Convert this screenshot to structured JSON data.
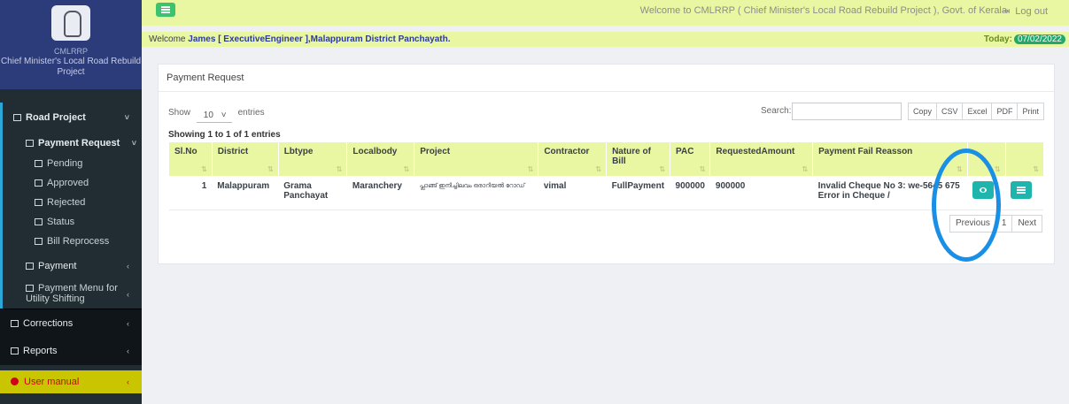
{
  "brand": {
    "short": "CMLRRP",
    "full": "Chief Minister's Local Road Rebuild Project"
  },
  "sidebar": {
    "road_project": "Road Project",
    "payment_request": "Payment Request",
    "pending": "Pending",
    "approved": "Approved",
    "rejected": "Rejected",
    "status": "Status",
    "bill_reprocess": "Bill Reprocess",
    "payment": "Payment",
    "payment_menu": "Payment Menu for Utility Shifting",
    "corrections": "Corrections",
    "reports": "Reports",
    "user_manual": "User manual"
  },
  "topbar": {
    "welcome": "Welcome to CMLRRP ( Chief Minister's Local Road Rebuild Project ), Govt. of Kerala",
    "logout": "Log out"
  },
  "infobar": {
    "welcome_prefix": "Welcome",
    "user": "James [ ExecutiveEngineer ]",
    "office": ",Malappuram District Panchayath.",
    "today_label": "Today:",
    "today_date": "07/02/2022"
  },
  "card": {
    "title": "Payment Request",
    "show_label": "Show",
    "entries_value": "10",
    "entries_label": "entries",
    "search_label": "Search:",
    "export_buttons": [
      "Copy",
      "CSV",
      "Excel",
      "PDF",
      "Print"
    ],
    "showing": "Showing 1 to 1 of 1 entries"
  },
  "table": {
    "headers": [
      "Sl.No",
      "District",
      "Lbtype",
      "Localbody",
      "Project",
      "Contractor",
      "Nature of Bill",
      "PAC",
      "RequestedAmount",
      "Payment Fail Reasson",
      "",
      ""
    ],
    "row": {
      "slno": "1",
      "district": "Malappuram",
      "lbtype": "Grama Panchayat",
      "localbody": "Maranchery",
      "project": "പ്ലാങ്ങ് ഇനിച്ചിലവം ഒരാറിയൽ റോഡ്",
      "contractor": "vimal",
      "nature": "FullPayment",
      "pac": "900000",
      "requested": "900000",
      "reason": "Invalid Cheque No 3: we-5645 675 Error in Cheque /"
    }
  },
  "pager": {
    "previous": "Previous",
    "page": "1",
    "next": "Next"
  },
  "colors": {
    "accent": "#e9f6a2",
    "sidebar": "#222d33",
    "action": "#1fb5ad",
    "highlight": "#1a8fe6"
  }
}
